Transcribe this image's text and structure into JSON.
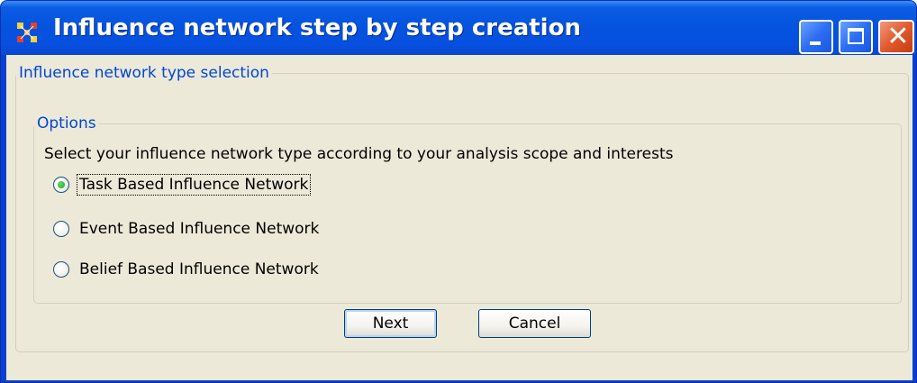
{
  "window": {
    "title": "Influence network step by step creation",
    "buttons": {
      "minimize": "minimize-icon",
      "maximize": "maximize-icon",
      "close": "close-icon"
    }
  },
  "panel": {
    "legend": "Influence network type selection",
    "options": {
      "legend": "Options",
      "description": "Select your influence network type according to your analysis scope and interests",
      "choices": [
        {
          "label": "Task Based Influence Network",
          "selected": true
        },
        {
          "label": "Event Based Influence Network",
          "selected": false
        },
        {
          "label": "Belief Based Influence Network",
          "selected": false
        }
      ]
    }
  },
  "actions": {
    "next": "Next",
    "cancel": "Cancel"
  },
  "colors": {
    "title_bar": "#0553df",
    "client_bg": "#ece9d8",
    "legend_text": "#0046d5",
    "close_button": "#e05a2e"
  }
}
